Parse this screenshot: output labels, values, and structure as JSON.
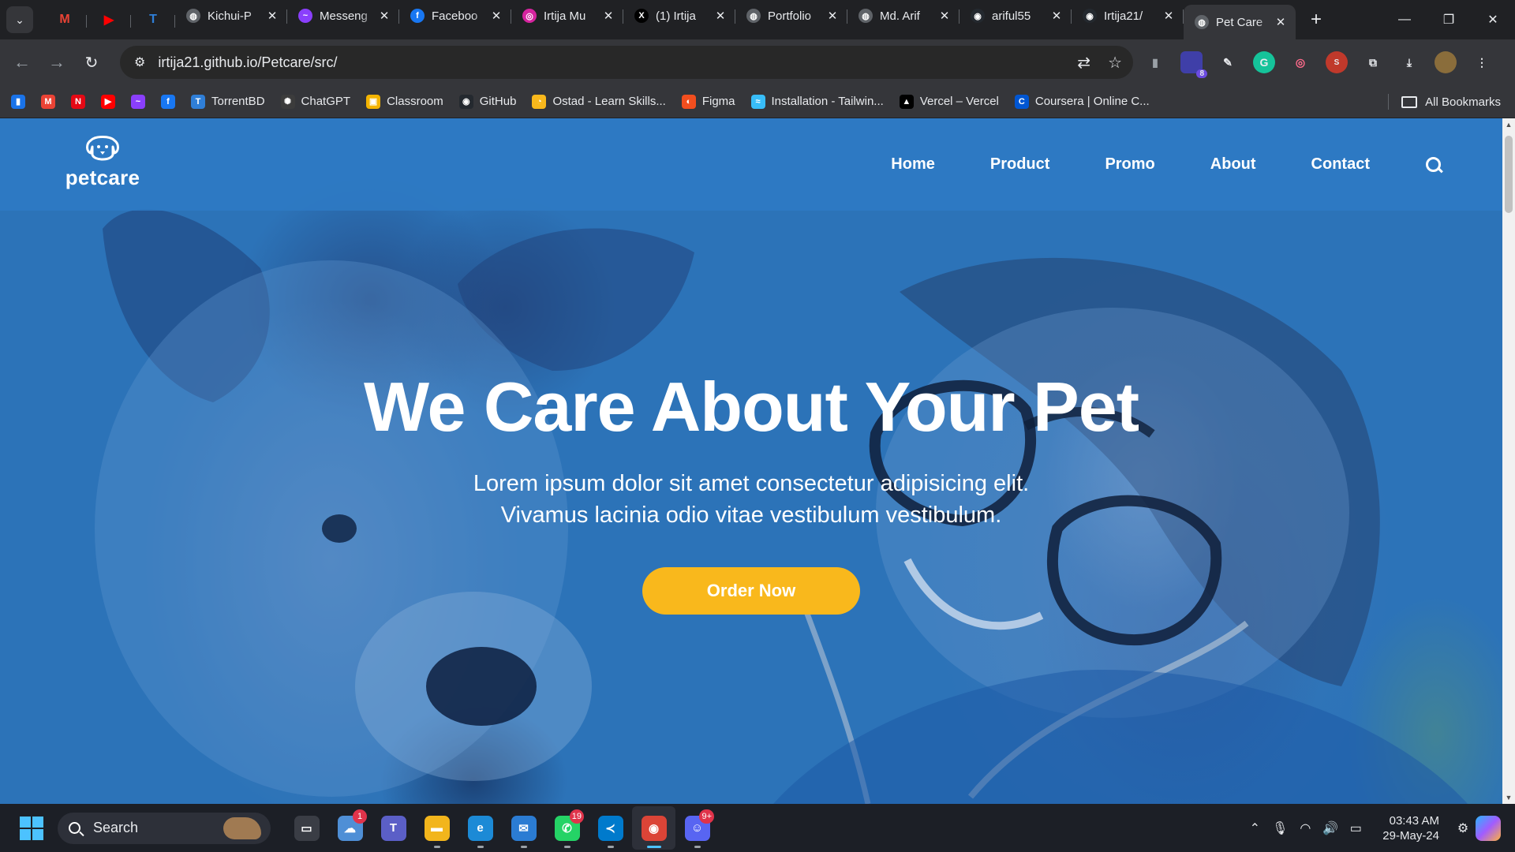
{
  "browser": {
    "pinned_tabs": [
      {
        "name": "gmail-icon",
        "glyph": "M",
        "color": "#ea4335"
      },
      {
        "name": "youtube-icon",
        "glyph": "▶",
        "color": "#ff0000"
      },
      {
        "name": "torrentbd-icon",
        "glyph": "T",
        "color": "#2f7fd8"
      }
    ],
    "tabs": [
      {
        "title": "Kichui-P",
        "icon": "globe-icon",
        "color": "#5f6368",
        "glyph": "◍"
      },
      {
        "title": "Messeng",
        "icon": "messenger-icon",
        "color": "#8a3ffc",
        "glyph": "~"
      },
      {
        "title": "Faceboo",
        "icon": "facebook-icon",
        "color": "#1877f2",
        "glyph": "f"
      },
      {
        "title": "Irtija Mu",
        "icon": "instagram-icon",
        "color": "#d6249f",
        "glyph": "◎"
      },
      {
        "title": "(1) Irtija",
        "icon": "x-icon",
        "color": "#000000",
        "glyph": "X"
      },
      {
        "title": "Portfolio",
        "icon": "globe-icon",
        "color": "#5f6368",
        "glyph": "◍"
      },
      {
        "title": "Md. Arif",
        "icon": "globe-icon",
        "color": "#5f6368",
        "glyph": "◍"
      },
      {
        "title": "ariful55",
        "icon": "github-icon",
        "color": "#24292f",
        "glyph": "◉"
      },
      {
        "title": "Irtija21/",
        "icon": "github-icon",
        "color": "#24292f",
        "glyph": "◉"
      },
      {
        "title": "Pet Care",
        "icon": "globe-icon",
        "color": "#5f6368",
        "glyph": "◍",
        "active": true
      }
    ],
    "url": "irtija21.github.io/Petcare/src/",
    "extension_badge": "8",
    "bookmarks": [
      {
        "label": "",
        "icon": "tracker-icon",
        "color": "#1a73e8",
        "glyph": "▮"
      },
      {
        "label": "",
        "icon": "gmail-icon",
        "color": "#ea4335",
        "glyph": "M"
      },
      {
        "label": "",
        "icon": "netflix-icon",
        "color": "#e50914",
        "glyph": "N"
      },
      {
        "label": "",
        "icon": "youtube-icon",
        "color": "#ff0000",
        "glyph": "▶"
      },
      {
        "label": "",
        "icon": "messenger-icon",
        "color": "#8a3ffc",
        "glyph": "~"
      },
      {
        "label": "",
        "icon": "facebook-icon",
        "color": "#1877f2",
        "glyph": "f"
      },
      {
        "label": "TorrentBD",
        "icon": "torrentbd-icon",
        "color": "#2f7fd8",
        "glyph": "T"
      },
      {
        "label": "ChatGPT",
        "icon": "chatgpt-icon",
        "color": "#3c3c3c",
        "glyph": "✺"
      },
      {
        "label": "Classroom",
        "icon": "classroom-icon",
        "color": "#f4b400",
        "glyph": "▣"
      },
      {
        "label": "GitHub",
        "icon": "github-icon",
        "color": "#24292f",
        "glyph": "◉"
      },
      {
        "label": "Ostad - Learn Skills...",
        "icon": "ostad-icon",
        "color": "#f9b81c",
        "glyph": "◔"
      },
      {
        "label": "Figma",
        "icon": "figma-icon",
        "color": "#f24e1e",
        "glyph": "◐"
      },
      {
        "label": "Installation - Tailwin...",
        "icon": "tailwind-icon",
        "color": "#38bdf8",
        "glyph": "≈"
      },
      {
        "label": "Vercel – Vercel",
        "icon": "vercel-icon",
        "color": "#000000",
        "glyph": "▲"
      },
      {
        "label": "Coursera | Online C...",
        "icon": "coursera-icon",
        "color": "#0056d2",
        "glyph": "C"
      }
    ],
    "all_bookmarks_label": "All Bookmarks"
  },
  "site": {
    "logo_text": "petcare",
    "nav": [
      "Home",
      "Product",
      "Promo",
      "About",
      "Contact"
    ],
    "hero_title": "We Care About Your Pet",
    "hero_subtitle": "Lorem ipsum dolor sit amet consectetur adipisicing elit. Vivamus lacinia odio vitae vestibulum vestibulum.",
    "cta_label": "Order Now",
    "colors": {
      "header_blue": "#2d7ac4",
      "cta_yellow": "#f9b81c",
      "text": "#ffffff"
    }
  },
  "taskbar": {
    "search_label": "Search",
    "apps": [
      {
        "name": "task-view-icon",
        "glyph": "▭",
        "color": "#3a3d45",
        "badge": ""
      },
      {
        "name": "weather-icon",
        "glyph": "☁",
        "color": "#4f8fd6",
        "badge": "1"
      },
      {
        "name": "teams-icon",
        "glyph": "T",
        "color": "#5b5fc7",
        "badge": ""
      },
      {
        "name": "file-explorer-icon",
        "glyph": "▬",
        "color": "#f2b51c",
        "badge": ""
      },
      {
        "name": "edge-icon",
        "glyph": "e",
        "color": "#1c8ad6",
        "badge": ""
      },
      {
        "name": "mail-icon",
        "glyph": "✉",
        "color": "#2b7cd3",
        "badge": ""
      },
      {
        "name": "whatsapp-icon",
        "glyph": "✆",
        "color": "#25d366",
        "badge": "19"
      },
      {
        "name": "vscode-icon",
        "glyph": "≺",
        "color": "#007acc",
        "badge": ""
      },
      {
        "name": "chrome-icon",
        "glyph": "◉",
        "color": "#db4437",
        "badge": "",
        "active": true
      },
      {
        "name": "discord-icon",
        "glyph": "☺",
        "color": "#5865f2",
        "badge": "9+"
      }
    ],
    "time": "03:43 AM",
    "date": "29-May-24"
  }
}
